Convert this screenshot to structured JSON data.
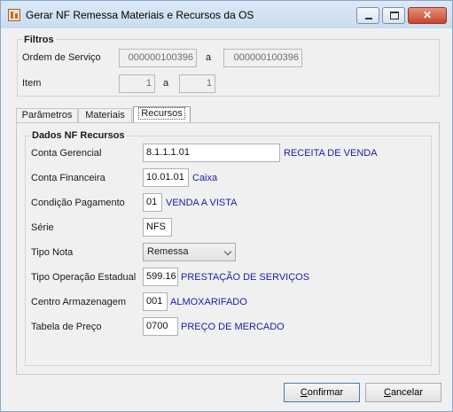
{
  "window": {
    "title": "Gerar NF Remessa Materiais e Recursos da OS",
    "buttons": {
      "minimize": "minimize-icon",
      "maximize": "maximize-icon",
      "close": "close-icon"
    }
  },
  "filtros": {
    "title": "Filtros",
    "ordem_servico": {
      "label": "Ordem de Serviço",
      "from": "000000100396",
      "sep": "a",
      "to": "000000100396"
    },
    "item": {
      "label": "Item",
      "from": "1",
      "sep": "a",
      "to": "1"
    }
  },
  "tabs": [
    {
      "label": "Parâmetros",
      "active": false
    },
    {
      "label": "Materiais",
      "active": false
    },
    {
      "label": "Recursos",
      "active": true
    }
  ],
  "dados": {
    "title": "Dados NF Recursos",
    "conta_gerencial": {
      "label": "Conta Gerencial",
      "value": "8.1.1.1.01",
      "desc": "RECEITA DE VENDA"
    },
    "conta_financeira": {
      "label": "Conta Financeira",
      "value": "10.01.01",
      "desc": "Caixa"
    },
    "condicao_pagamento": {
      "label": "Condição Pagamento",
      "value": "01",
      "desc": "VENDA A VISTA"
    },
    "serie": {
      "label": "Série",
      "value": "NFS"
    },
    "tipo_nota": {
      "label": "Tipo Nota",
      "value": "Remessa"
    },
    "tipo_operacao": {
      "label": "Tipo Operação Estadual",
      "value": "599.16",
      "desc": "PRESTAÇÃO DE SERVIÇOS"
    },
    "centro_armazenagem": {
      "label": "Centro Armazenagem",
      "value": "001",
      "desc": "ALMOXARIFADO"
    },
    "tabela_preco": {
      "label": "Tabela de Preço",
      "value": "0700",
      "desc": "PREÇO DE MERCADO"
    }
  },
  "footer": {
    "confirmar": {
      "first": "C",
      "rest": "onfirmar"
    },
    "cancelar": {
      "first": "C",
      "rest": "ancelar"
    }
  },
  "colors": {
    "desc_text": "#1c1ca6",
    "title_bar": "#dce9f6",
    "close_button": "#c6452c"
  }
}
